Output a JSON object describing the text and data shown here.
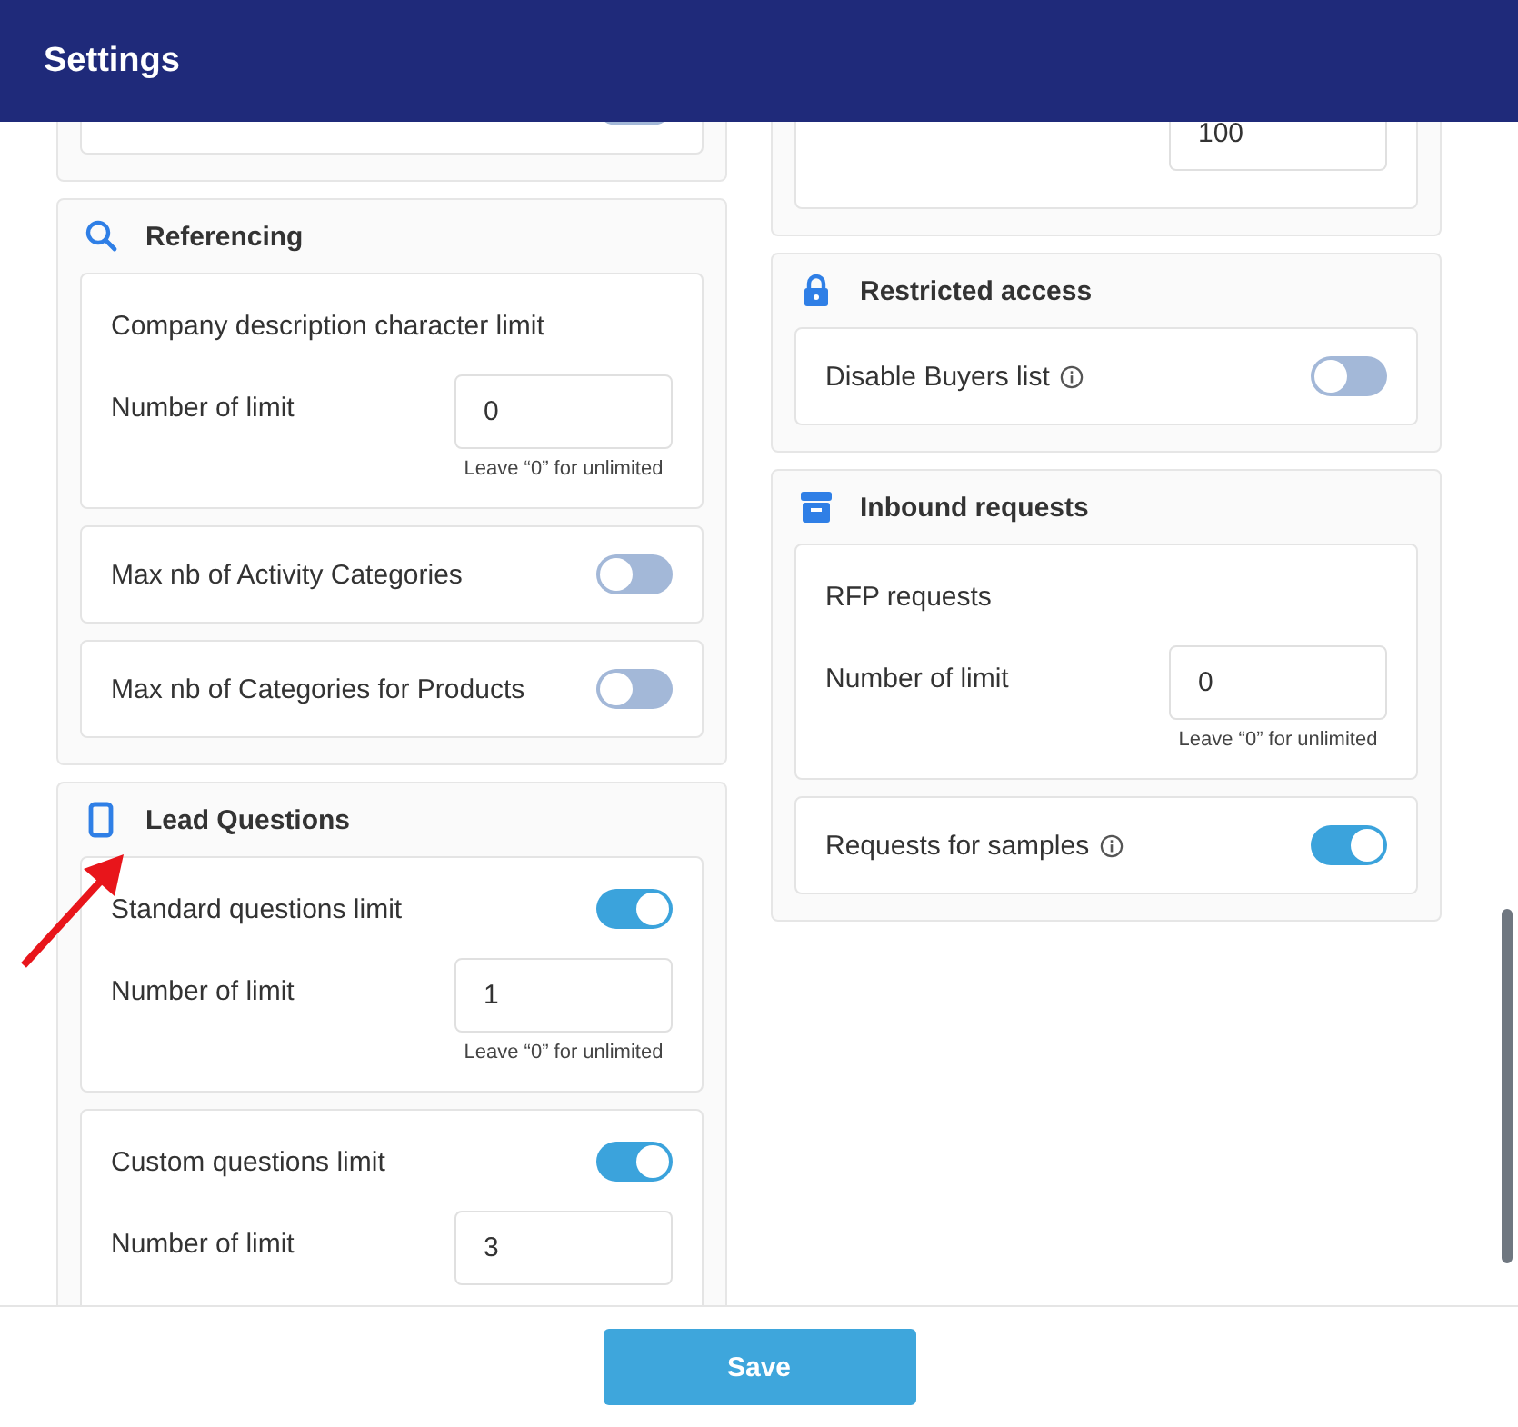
{
  "window": {
    "title": "Settings"
  },
  "columns": [
    {
      "sections": [
        {
          "cards": [
            {
              "kind": "toggle",
              "on": false
            }
          ]
        },
        {
          "title": "Referencing",
          "cards": [
            {
              "kind": "limit",
              "label": "Company description character limit",
              "field_label": "Number of limit",
              "value": "0",
              "hint": "Leave “0” for unlimited"
            },
            {
              "kind": "toggle",
              "label": "Max nb of Activity Categories",
              "on": false
            },
            {
              "kind": "toggle",
              "label": "Max nb of Categories for Products",
              "on": false
            }
          ]
        },
        {
          "title": "Lead Questions",
          "cards": [
            {
              "kind": "toggle_limit",
              "label": "Standard questions limit",
              "on": true,
              "field_label": "Number of limit",
              "value": "1",
              "hint": "Leave “0” for unlimited"
            },
            {
              "kind": "toggle_limit",
              "label": "Custom questions limit",
              "on": true,
              "field_label": "Number of limit",
              "value": "3"
            }
          ]
        }
      ]
    },
    {
      "sections": [
        {
          "cards": [
            {
              "kind": "limit",
              "value": "100"
            }
          ]
        },
        {
          "title": "Restricted access",
          "cards": [
            {
              "kind": "toggle",
              "label": "Disable Buyers list",
              "info": true,
              "on": false
            }
          ]
        },
        {
          "title": "Inbound requests",
          "cards": [
            {
              "kind": "limit",
              "label": "RFP requests",
              "field_label": "Number of limit",
              "value": "0",
              "hint": "Leave “0” for unlimited"
            },
            {
              "kind": "toggle",
              "label": "Requests for samples",
              "info": true,
              "on": true
            }
          ]
        }
      ]
    }
  ],
  "footer": {
    "save_button": "Save"
  }
}
